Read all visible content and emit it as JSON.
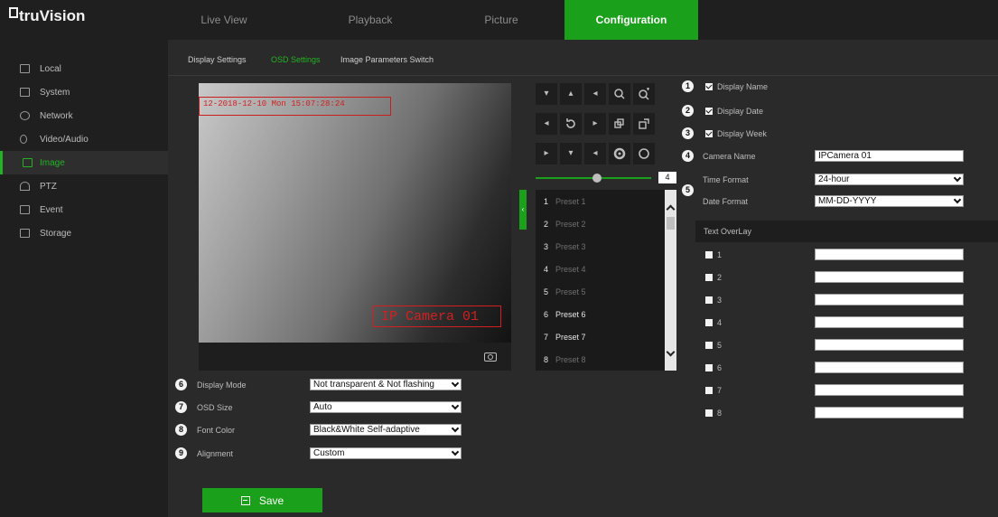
{
  "app": {
    "logo": "truVision"
  },
  "nav": {
    "tabs": [
      {
        "label": "Live View"
      },
      {
        "label": "Playback"
      },
      {
        "label": "Picture"
      },
      {
        "label": "Configuration",
        "active": true
      }
    ]
  },
  "sidebar": {
    "items": [
      {
        "label": "Local",
        "icon": "monitor-icon"
      },
      {
        "label": "System",
        "icon": "system-icon"
      },
      {
        "label": "Network",
        "icon": "globe-icon"
      },
      {
        "label": "Video/Audio",
        "icon": "video-audio-icon"
      },
      {
        "label": "Image",
        "icon": "image-icon",
        "active": true
      },
      {
        "label": "PTZ",
        "icon": "ptz-icon"
      },
      {
        "label": "Event",
        "icon": "event-icon"
      },
      {
        "label": "Storage",
        "icon": "storage-icon"
      }
    ]
  },
  "subtabs": [
    {
      "label": "Display Settings"
    },
    {
      "label": "OSD Settings",
      "active": true
    },
    {
      "label": "Image Parameters Switch"
    }
  ],
  "video": {
    "osd_top_text": "12-2018-12-10 Mon 15:07:28:24",
    "osd_camera_text": "IP Camera 01"
  },
  "ptz": {
    "buttons": [
      "▾",
      "▴",
      "◂",
      "zoom-out",
      "zoom-in",
      "◂",
      "↻",
      "▸",
      "focus-near",
      "focus-far",
      "▸",
      "▾",
      "◂",
      "iris-close",
      "iris-open"
    ],
    "speed": "4"
  },
  "presets": [
    {
      "num": "1",
      "name": "Preset 1",
      "set": false
    },
    {
      "num": "2",
      "name": "Preset 2",
      "set": false
    },
    {
      "num": "3",
      "name": "Preset 3",
      "set": false
    },
    {
      "num": "4",
      "name": "Preset 4",
      "set": false
    },
    {
      "num": "5",
      "name": "Preset 5",
      "set": false
    },
    {
      "num": "6",
      "name": "Preset 6",
      "set": true
    },
    {
      "num": "7",
      "name": "Preset 7",
      "set": true
    },
    {
      "num": "8",
      "name": "Preset 8",
      "set": false
    }
  ],
  "osd_form": {
    "display_mode": {
      "badge": "6",
      "label": "Display Mode",
      "value": "Not transparent & Not flashing"
    },
    "osd_size": {
      "badge": "7",
      "label": "OSD Size",
      "value": "Auto"
    },
    "font_color": {
      "badge": "8",
      "label": "Font Color",
      "value": "Black&White Self-adaptive"
    },
    "alignment": {
      "badge": "9",
      "label": "Alignment",
      "value": "Custom"
    }
  },
  "save_label": "Save",
  "right": {
    "display_name": {
      "badge": "1",
      "label": "Display Name",
      "checked": true
    },
    "display_date": {
      "badge": "2",
      "label": "Display Date",
      "checked": true
    },
    "display_week": {
      "badge": "3",
      "label": "Display Week",
      "checked": true
    },
    "camera_name": {
      "badge": "4",
      "label": "Camera Name",
      "value": "IPCamera 01"
    },
    "time_format": {
      "badge": "5",
      "label": "Time Format",
      "value": "24-hour"
    },
    "date_format": {
      "label": "Date Format",
      "value": "MM-DD-YYYY"
    },
    "overlay_title": "Text OverLay",
    "overlays": [
      {
        "num": "1",
        "value": ""
      },
      {
        "num": "2",
        "value": ""
      },
      {
        "num": "3",
        "value": ""
      },
      {
        "num": "4",
        "value": ""
      },
      {
        "num": "5",
        "value": ""
      },
      {
        "num": "6",
        "value": ""
      },
      {
        "num": "7",
        "value": ""
      },
      {
        "num": "8",
        "value": ""
      }
    ]
  },
  "colors": {
    "accent": "#1aa01a",
    "osd_red": "#d22020",
    "background": "#2a2a2a"
  }
}
